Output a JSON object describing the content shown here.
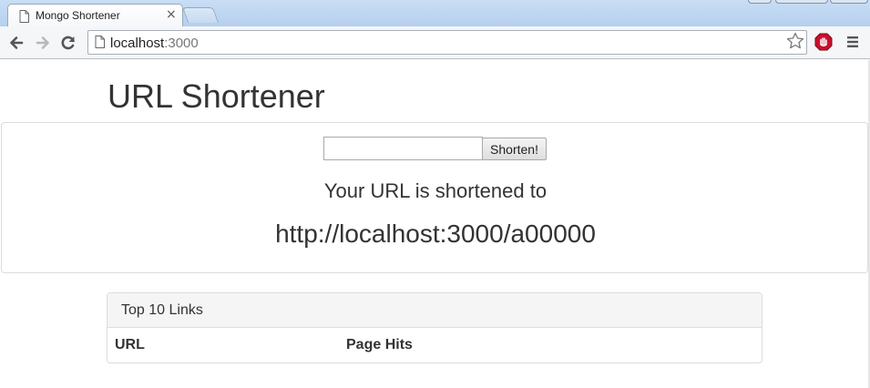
{
  "browser": {
    "tab_title": "Mongo Shortener",
    "tab_close": "×",
    "address_host": "localhost",
    "address_port": ":3000"
  },
  "page": {
    "title": "URL Shortener",
    "form": {
      "input_value": "",
      "button_label": "Shorten!"
    },
    "result": {
      "label": "Your URL is shortened to",
      "short_url": "http://localhost:3000/a00000"
    },
    "top_links": {
      "heading": "Top 10 Links",
      "columns": [
        "URL",
        "Page Hits"
      ]
    }
  },
  "icons": {
    "tab": "document-icon",
    "back": "back-arrow-icon",
    "forward": "forward-arrow-icon",
    "reload": "reload-icon",
    "page": "page-icon",
    "bookmark": "star-icon",
    "extension": "adblock-icon",
    "menu": "hamburger-menu-icon"
  },
  "colors": {
    "extension_red": "#c8102e",
    "chrome_blue": "#b5cfee"
  }
}
